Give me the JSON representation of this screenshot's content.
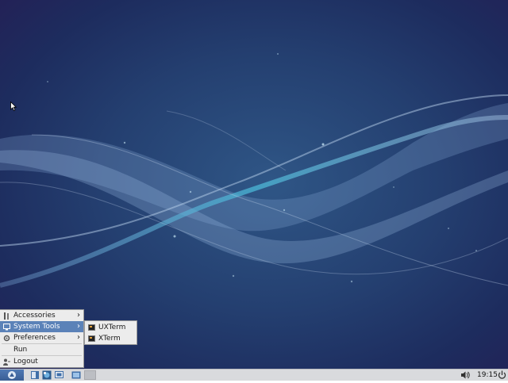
{
  "desktop": {
    "colors": {
      "bg_dark": "#1d2c5e",
      "bg_mid": "#2f5686",
      "ribbon": "#4ab7d6"
    }
  },
  "start_menu": {
    "items": [
      {
        "label": "Accessories",
        "icon": "accessories-icon",
        "has_submenu": true,
        "selected": false
      },
      {
        "label": "System Tools",
        "icon": "monitor-icon",
        "has_submenu": true,
        "selected": true
      },
      {
        "label": "Preferences",
        "icon": "gear-icon",
        "has_submenu": true,
        "selected": false
      },
      {
        "label": "Run",
        "icon": "",
        "has_submenu": false,
        "selected": false
      },
      {
        "label": "Logout",
        "icon": "logout-icon",
        "has_submenu": false,
        "selected": false
      }
    ],
    "submenu_system_tools": [
      {
        "label": "UXTerm",
        "icon": "terminal-icon"
      },
      {
        "label": "XTerm",
        "icon": "terminal-icon"
      }
    ],
    "colors": {
      "bg": "#ececec",
      "highlight": "#5b82b8"
    }
  },
  "panel": {
    "launchers": [
      "file-manager-icon",
      "web-browser-icon",
      "desktop-switcher-icon",
      "show-desktop-icon"
    ],
    "clock": "19:15",
    "colors": {
      "bg": "#d9dadd",
      "start": "#4f79b4"
    }
  }
}
